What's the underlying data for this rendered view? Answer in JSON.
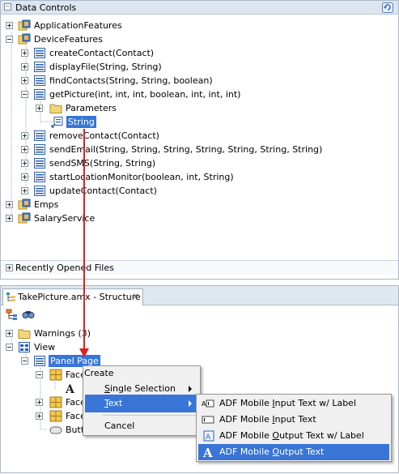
{
  "data_controls": {
    "title": "Data Controls",
    "items": {
      "app_features": "ApplicationFeatures",
      "device_features": "DeviceFeatures",
      "create_contact": "createContact(Contact)",
      "display_file": "displayFile(String, String)",
      "find_contacts": "findContacts(String, String, boolean)",
      "get_picture": "getPicture(int, int, int, boolean, int, int, int)",
      "parameters": "Parameters",
      "string": "String",
      "remove_contact": "removeContact(Contact)",
      "send_email": "sendEmail(String, String, String, String, String, String, String)",
      "send_sms": "sendSMS(String, String)",
      "start_location": "startLocationMonitor(boolean, int, String)",
      "update_contact": "updateContact(Contact)",
      "emps": "Emps",
      "salary_service": "SalaryService"
    },
    "recent_files": "Recently Opened Files"
  },
  "structure": {
    "tab_title": "TakePicture.amx - Structure",
    "warnings": "Warnings (3)",
    "view": "View",
    "panel_page": "Panel Page",
    "facet1": "Face",
    "facet2": "Face",
    "facet3": "Face",
    "button": "Butt"
  },
  "context_menu": {
    "create": "Create",
    "single_selection": "ingle Selection",
    "single_selection_mnemonic": "S",
    "text": "ext",
    "text_mnemonic": "T",
    "cancel": "Cancel"
  },
  "submenu": {
    "input_label_pre": "ADF Mobile ",
    "input_label_mn": "I",
    "input_label_post": "nput Text w/ Label",
    "input_pre": "ADF Mobile ",
    "input_mn": "I",
    "input_post": "nput Text",
    "output_label_pre": "ADF Mobile ",
    "output_label_mn": "O",
    "output_label_post": "utput Text w/ Label",
    "output_pre": "ADF Mobile ",
    "output_mn": "O",
    "output_post": "utput Text"
  },
  "colors": {
    "selection": "#3875d7",
    "arrow": "#e02020"
  }
}
